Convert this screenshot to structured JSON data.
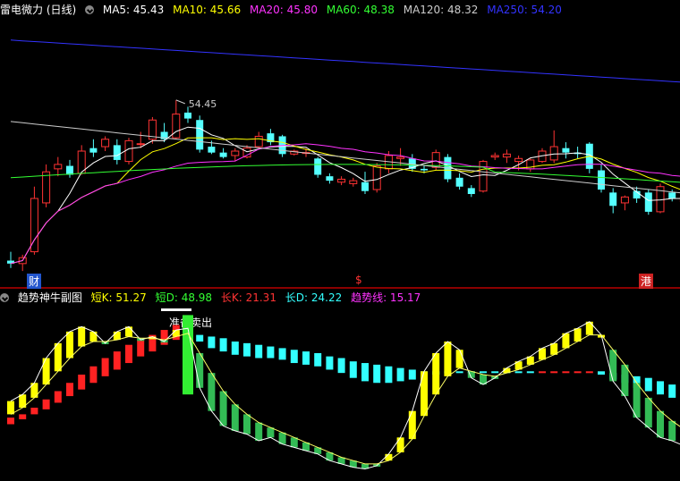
{
  "top_panel": {
    "title": "雷电微力 (日线)",
    "ma_labels": [
      {
        "text": "MA5: 45.43",
        "color": "#ffffff"
      },
      {
        "text": "MA10: 45.66",
        "color": "#ffff00"
      },
      {
        "text": "MA20: 45.80",
        "color": "#ff33ff"
      },
      {
        "text": "MA60: 48.38",
        "color": "#33ff33"
      },
      {
        "text": "MA120: 48.32",
        "color": "#cccccc"
      },
      {
        "text": "MA250: 54.20",
        "color": "#3333ff"
      }
    ],
    "max_label": "54.45",
    "markers": [
      {
        "text": "财",
        "color": "#ffffff",
        "bg": "#2255cc"
      },
      {
        "text": "$",
        "color": "#ff3333",
        "bg": "transparent"
      },
      {
        "text": "港",
        "color": "#ffffff",
        "bg": "#cc2222"
      }
    ]
  },
  "bottom_panel": {
    "title": "趋势神牛副图",
    "labels": [
      {
        "text": "短K: 51.27",
        "color": "#ffff00"
      },
      {
        "text": "短D: 48.98",
        "color": "#33ff33"
      },
      {
        "text": "长K: 21.31",
        "color": "#ff3333"
      },
      {
        "text": "长D: 24.22",
        "color": "#33ffff"
      },
      {
        "text": "趋势线: 15.17",
        "color": "#ff33ff"
      }
    ],
    "signal_text": "准备卖出"
  },
  "chart_data": [
    {
      "type": "candlestick",
      "title": "雷电微力 (日线)",
      "ylim": [
        42,
        60
      ],
      "candles": [
        [
          43.6,
          44.2,
          43.1,
          43.4
        ],
        [
          43.4,
          44.0,
          42.9,
          43.8
        ],
        [
          44.2,
          48.6,
          44.0,
          47.8
        ],
        [
          47.5,
          50.1,
          47.2,
          49.6
        ],
        [
          49.8,
          50.6,
          49.3,
          50.1
        ],
        [
          50.0,
          50.4,
          49.2,
          49.4
        ],
        [
          49.5,
          51.4,
          49.4,
          51.0
        ],
        [
          51.2,
          51.8,
          50.6,
          50.9
        ],
        [
          51.3,
          52.0,
          51.0,
          51.8
        ],
        [
          51.4,
          51.8,
          50.1,
          50.4
        ],
        [
          50.3,
          51.9,
          50.1,
          51.7
        ],
        [
          51.5,
          52.3,
          51.2,
          51.5
        ],
        [
          51.8,
          53.3,
          51.5,
          53.1
        ],
        [
          52.3,
          52.9,
          51.6,
          51.8
        ],
        [
          51.9,
          54.45,
          51.8,
          53.5
        ],
        [
          53.6,
          54.0,
          52.9,
          53.2
        ],
        [
          53.1,
          53.4,
          50.9,
          51.1
        ],
        [
          51.3,
          51.7,
          50.8,
          50.9
        ],
        [
          50.9,
          51.2,
          50.5,
          50.6
        ],
        [
          50.7,
          51.2,
          50.3,
          51.0
        ],
        [
          50.6,
          51.4,
          50.5,
          51.2
        ],
        [
          51.3,
          52.3,
          51.1,
          52.0
        ],
        [
          52.2,
          52.5,
          51.4,
          51.6
        ],
        [
          52.0,
          52.1,
          50.6,
          50.8
        ],
        [
          50.8,
          51.1,
          50.7,
          51.0
        ],
        [
          50.9,
          51.2,
          50.6,
          50.9
        ],
        [
          50.5,
          50.6,
          49.2,
          49.4
        ],
        [
          49.3,
          49.5,
          48.8,
          49.0
        ],
        [
          48.9,
          49.3,
          48.7,
          49.1
        ],
        [
          48.8,
          49.2,
          48.6,
          49.0
        ],
        [
          48.9,
          49.6,
          48.1,
          48.3
        ],
        [
          48.4,
          50.2,
          48.2,
          50.0
        ],
        [
          49.8,
          51.0,
          49.5,
          50.7
        ],
        [
          50.5,
          51.2,
          50.0,
          50.6
        ],
        [
          50.5,
          50.8,
          49.6,
          49.8
        ],
        [
          49.8,
          50.0,
          49.5,
          49.7
        ],
        [
          49.9,
          51.1,
          49.7,
          50.9
        ],
        [
          50.6,
          50.8,
          48.9,
          49.1
        ],
        [
          49.2,
          49.5,
          48.4,
          48.6
        ],
        [
          48.5,
          48.7,
          47.9,
          48.1
        ],
        [
          48.3,
          50.4,
          48.2,
          50.3
        ],
        [
          50.6,
          50.9,
          50.4,
          50.7
        ],
        [
          50.6,
          51.1,
          50.2,
          50.8
        ],
        [
          50.3,
          50.7,
          49.7,
          50.5
        ],
        [
          49.8,
          50.5,
          49.6,
          50.4
        ],
        [
          50.3,
          51.2,
          50.2,
          51.0
        ],
        [
          50.4,
          52.4,
          50.2,
          51.3
        ],
        [
          51.2,
          51.6,
          50.5,
          50.9
        ],
        [
          50.9,
          51.3,
          50.5,
          50.8
        ],
        [
          51.5,
          51.6,
          49.5,
          49.8
        ],
        [
          49.7,
          50.1,
          48.2,
          48.4
        ],
        [
          48.2,
          48.5,
          46.8,
          47.3
        ],
        [
          47.5,
          48.0,
          47.0,
          47.9
        ],
        [
          48.3,
          48.6,
          47.5,
          47.8
        ],
        [
          48.2,
          48.4,
          46.7,
          46.9
        ],
        [
          46.9,
          48.8,
          46.8,
          48.6
        ],
        [
          48.2,
          48.4,
          47.6,
          47.8
        ],
        [
          47.6,
          48.1,
          47.2,
          47.9
        ]
      ]
    },
    {
      "type": "bar",
      "title": "趋势神牛副图",
      "ylim": [
        0,
        100
      ],
      "series": [
        {
          "name": "短K",
          "values": [
            44,
            48,
            55,
            70,
            79,
            86,
            89,
            86,
            79,
            86,
            89,
            81,
            83,
            80,
            87,
            88,
            52,
            38,
            29,
            26,
            24,
            20,
            22,
            18,
            16,
            14,
            12,
            8,
            6,
            4,
            3,
            5,
            12,
            22,
            38,
            62,
            73,
            80,
            75,
            58,
            54,
            58,
            64,
            68,
            71,
            76,
            79,
            85,
            88,
            92,
            84,
            56,
            47,
            34,
            28,
            22,
            20,
            17
          ]
        },
        {
          "name": "短D",
          "values": [
            36,
            40,
            46,
            54,
            62,
            70,
            77,
            80,
            80,
            81,
            83,
            82,
            82,
            81,
            83,
            85,
            73,
            61,
            50,
            42,
            36,
            31,
            28,
            25,
            22,
            19,
            16,
            13,
            10,
            8,
            6,
            6,
            8,
            13,
            21,
            35,
            48,
            59,
            64,
            62,
            60,
            59,
            61,
            63,
            66,
            69,
            72,
            76,
            80,
            84,
            84,
            75,
            66,
            55,
            46,
            38,
            32,
            27
          ]
        },
        {
          "name": "长K",
          "values": [
            34,
            36,
            40,
            45,
            50,
            55,
            60,
            65,
            70,
            74,
            78,
            81,
            84,
            87,
            90,
            92,
            80,
            76,
            74,
            72,
            71,
            70,
            70,
            69,
            67,
            66,
            65,
            63,
            61,
            58,
            56,
            55,
            55,
            56,
            57,
            58,
            60,
            61,
            61,
            61,
            61,
            61,
            61,
            61,
            61,
            62,
            62,
            62,
            62,
            62,
            60,
            57,
            55,
            52,
            50,
            48,
            46,
            44
          ]
        },
        {
          "name": "长D",
          "values": [
            30,
            33,
            36,
            39,
            43,
            47,
            51,
            55,
            59,
            63,
            67,
            71,
            74,
            78,
            81,
            84,
            84,
            83,
            82,
            80,
            79,
            78,
            77,
            76,
            75,
            74,
            73,
            71,
            70,
            68,
            67,
            66,
            65,
            64,
            63,
            62,
            62,
            62,
            62,
            62,
            62,
            62,
            62,
            62,
            62,
            62,
            62,
            62,
            62,
            62,
            62,
            61,
            60,
            59,
            58,
            56,
            54,
            52
          ]
        }
      ]
    }
  ]
}
